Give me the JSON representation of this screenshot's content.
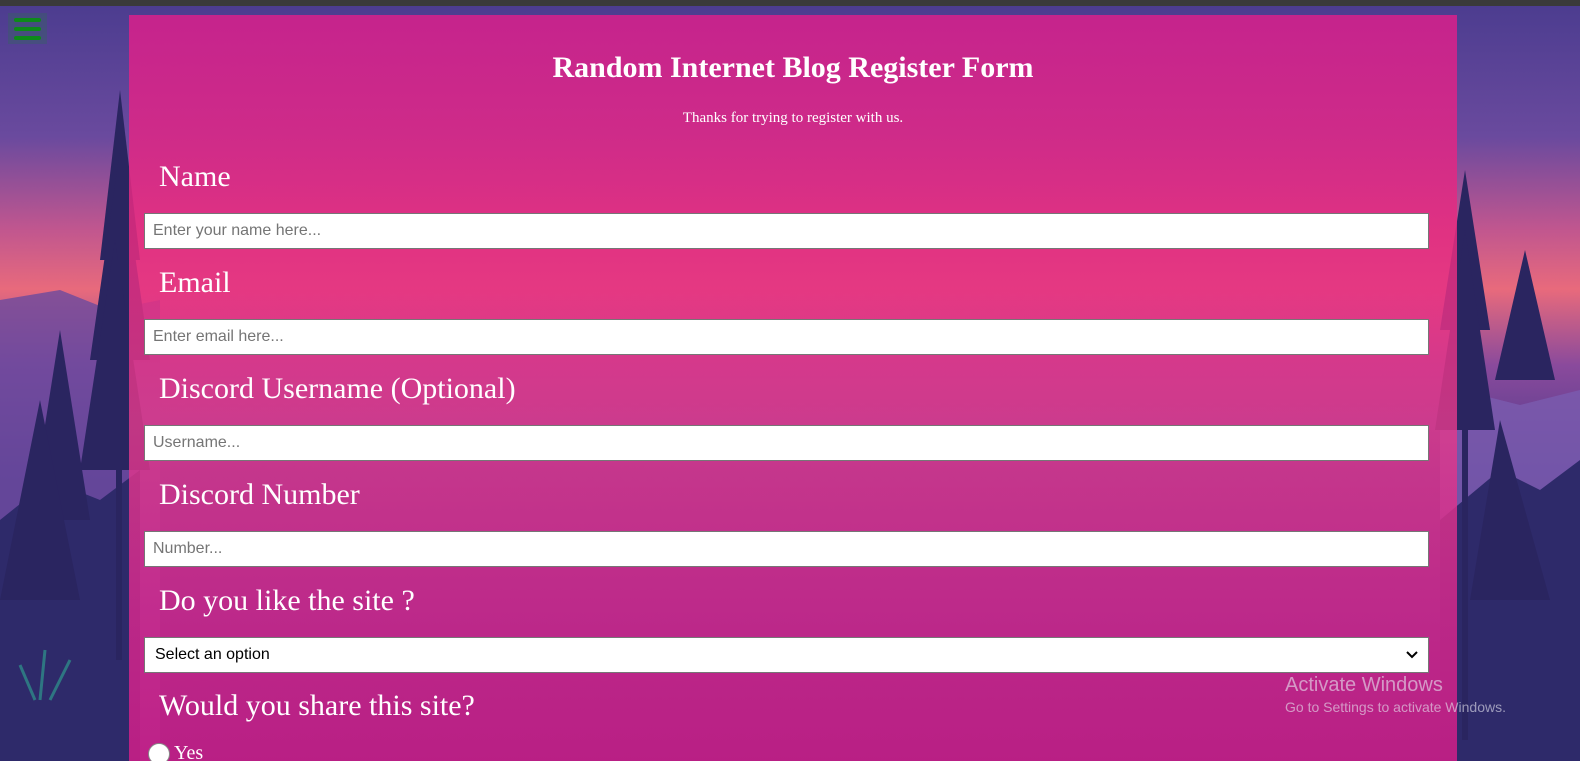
{
  "form": {
    "title": "Random Internet Blog Register Form",
    "subtitle": "Thanks for trying to register with us.",
    "fields": {
      "name": {
        "label": "Name",
        "placeholder": "Enter your name here..."
      },
      "email": {
        "label": "Email",
        "placeholder": "Enter email here..."
      },
      "discord_username": {
        "label": "Discord Username (Optional)",
        "placeholder": "Username..."
      },
      "discord_number": {
        "label": "Discord Number",
        "placeholder": "Number..."
      },
      "like_site": {
        "label": "Do you like the site ?",
        "selected": "Select an option"
      },
      "share_site": {
        "label": "Would you share this site?",
        "option_yes": "Yes"
      }
    }
  },
  "watermark": {
    "line1": "Activate Windows",
    "line2": "Go to Settings to activate Windows."
  },
  "colors": {
    "panel": "#e02a86",
    "menu_icon": "#0d8a1a"
  },
  "icons": {
    "menu": "hamburger-icon",
    "select_arrow": "chevron-down-icon"
  }
}
